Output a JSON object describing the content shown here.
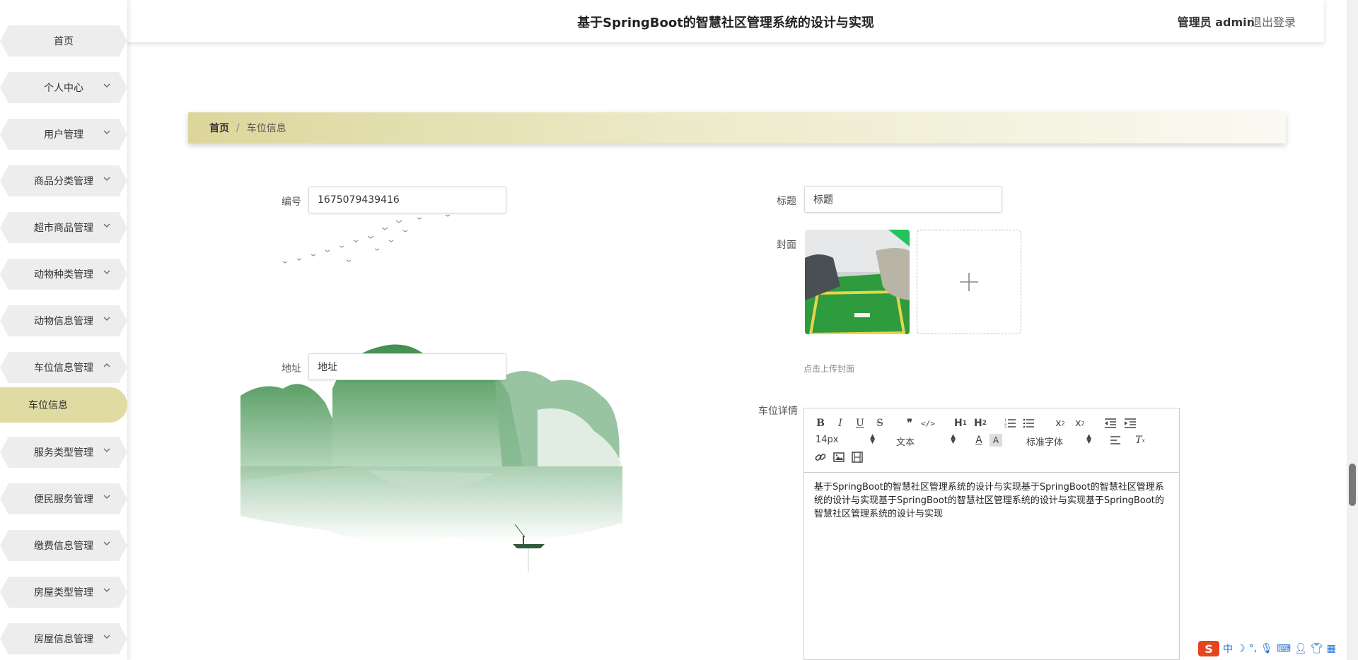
{
  "header": {
    "title": "基于SpringBoot的智慧社区管理系统的设计与实现",
    "admin_label": "管理员 admin",
    "logout_label": "退出登录"
  },
  "sidebar": {
    "items": [
      {
        "label": "首页",
        "has_chevron": false
      },
      {
        "label": "个人中心",
        "has_chevron": true
      },
      {
        "label": "用户管理",
        "has_chevron": true
      },
      {
        "label": "商品分类管理",
        "has_chevron": true
      },
      {
        "label": "超市商品管理",
        "has_chevron": true
      },
      {
        "label": "动物种类管理",
        "has_chevron": true
      },
      {
        "label": "动物信息管理",
        "has_chevron": true
      },
      {
        "label": "车位信息管理",
        "has_chevron": true,
        "expanded": true
      },
      {
        "label": "服务类型管理",
        "has_chevron": true
      },
      {
        "label": "便民服务管理",
        "has_chevron": true
      },
      {
        "label": "缴费信息管理",
        "has_chevron": true
      },
      {
        "label": "房屋类型管理",
        "has_chevron": true
      },
      {
        "label": "房屋信息管理",
        "has_chevron": true
      }
    ],
    "active_sub_item": "车位信息"
  },
  "breadcrumb": {
    "home": "首页",
    "separator": "/",
    "current": "车位信息"
  },
  "form": {
    "number_label": "编号",
    "number_value": "1675079439416",
    "title_label": "标题",
    "title_value": "标题",
    "address_label": "地址",
    "address_value": "地址",
    "cover_label": "封面",
    "cover_hint": "点击上传封面",
    "detail_label": "车位详情"
  },
  "editor": {
    "font_size": "14px",
    "block_type": "文本",
    "font_family": "标准字体",
    "content": "基于SpringBoot的智慧社区管理系统的设计与实现基于SpringBoot的智慧社区管理系统的设计与实现基于SpringBoot的智慧社区管理系统的设计与实现基于SpringBoot的智慧社区管理系统的设计与实现"
  },
  "ime": {
    "logo": "S",
    "mode": "中"
  },
  "colors": {
    "accent": "#e0dba2",
    "breadcrumb_start": "#dcd69c",
    "sidebar_item_bg": "#ededed"
  }
}
